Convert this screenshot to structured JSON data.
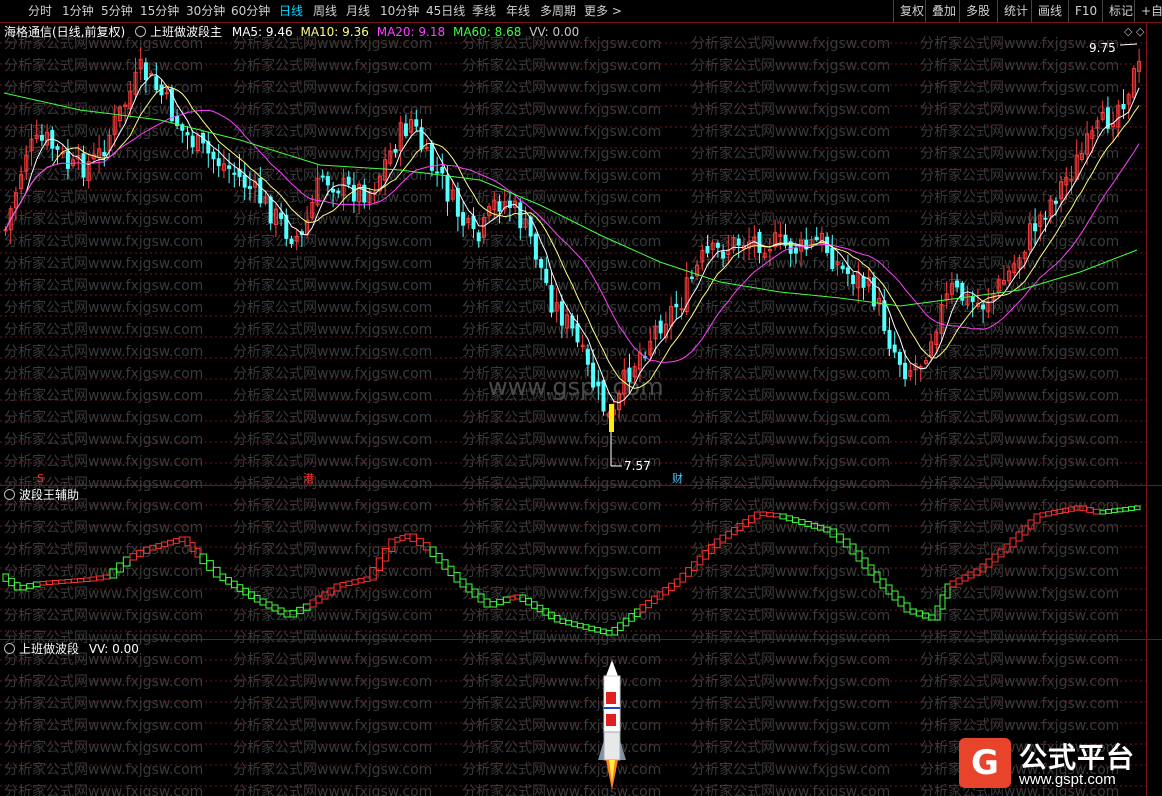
{
  "toolbar": {
    "periods": [
      "分时",
      "1分钟",
      "5分钟",
      "15分钟",
      "30分钟",
      "60分钟",
      "日线",
      "周线",
      "月线",
      "10分钟",
      "45日线",
      "季线",
      "年线",
      "多周期",
      "更多 >"
    ],
    "active_index": 6,
    "right_buttons": [
      "复权",
      "叠加",
      "多股",
      "统计",
      "画线",
      "F10",
      "标记",
      "+自选"
    ]
  },
  "main_pane": {
    "stock_name": "海格通信(日线,前复权)",
    "indicator_name": "上班做波段主",
    "ma5": "MA5: 9.46",
    "ma10": "MA10: 9.36",
    "ma20": "MA20: 9.18",
    "ma60": "MA60: 8.68",
    "vv": "VV: 0.00",
    "high_label": "9.75",
    "low_label": "7.57",
    "markers": [
      "S",
      "港",
      "财"
    ],
    "watermark_center": "www.gspt.com"
  },
  "sub_pane1": {
    "title": "波段王辅助"
  },
  "sub_pane2": {
    "title": "上班做波段",
    "vv": "VV: 0.00"
  },
  "watermark": {
    "text": "分析家公式网www.fxjgsw.com"
  },
  "logo": {
    "glyph": "G",
    "title": "公式平台",
    "url": "www.gspt.com"
  },
  "colors": {
    "up": "#ff3c3c",
    "down": "#54ffff",
    "ma5": "#ffffff",
    "ma10": "#ffff80",
    "ma20": "#ff40ff",
    "ma60": "#40ff40",
    "grid": "#7a1414",
    "wave_up": "#ff3030",
    "wave_down": "#40ff40",
    "rocket_red": "#e02020"
  }
}
